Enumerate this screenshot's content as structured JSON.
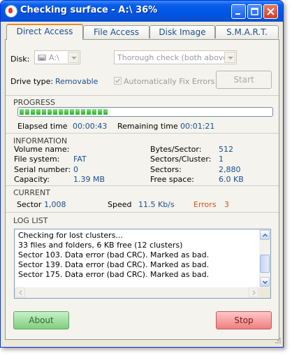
{
  "window": {
    "title": "Checking surface - A:\\ 36%"
  },
  "tabs": [
    {
      "label": "Direct Access"
    },
    {
      "label": "File Access"
    },
    {
      "label": "Disk Image"
    },
    {
      "label": "S.M.A.R.T."
    }
  ],
  "disk": {
    "label": "Disk:",
    "drive_value": "A:\\",
    "mode_value": "Thorough check (both above)",
    "drive_type_label": "Drive type:",
    "drive_type_value": "Removable",
    "auto_fix_label": "Automatically Fix Errors",
    "auto_fix_checked": true,
    "start_label": "Start"
  },
  "progress": {
    "header": "PROGRESS",
    "percent": 36,
    "elapsed_label": "Elapsed time",
    "elapsed_value": "00:00:43",
    "remaining_label": "Remaining time",
    "remaining_value": "00:01:21"
  },
  "information": {
    "header": "INFORMATION",
    "left": [
      {
        "label": "Volume name:",
        "value": ""
      },
      {
        "label": "File system:",
        "value": "FAT"
      },
      {
        "label": "Serial number:",
        "value": "0"
      },
      {
        "label": "Capacity:",
        "value": "1.39 MB"
      }
    ],
    "right": [
      {
        "label": "Bytes/Sector:",
        "value": "512"
      },
      {
        "label": "Sectors/Cluster:",
        "value": "1"
      },
      {
        "label": "Sectors:",
        "value": "2,880"
      },
      {
        "label": "Free space:",
        "value": "6.0 KB"
      }
    ]
  },
  "current": {
    "header": "CURRENT",
    "sector_label": "Sector",
    "sector_value": "1,008",
    "speed_label": "Speed",
    "speed_value": "11.5 Kb/s",
    "errors_label": "Errors",
    "errors_value": "3"
  },
  "log": {
    "header": "LOG LIST",
    "lines": [
      "Checking for lost clusters...",
      "33 files and folders, 6 KB free (12 clusters)",
      "Sector 103. Data error (bad CRC). Marked as bad.",
      "Sector 139. Data error (bad CRC). Marked as bad.",
      "Sector 175. Data error (bad CRC). Marked as bad."
    ]
  },
  "buttons": {
    "about": "About",
    "stop": "Stop"
  },
  "colors": {
    "accent": "#1b4f8c",
    "error": "#d9531e",
    "progress": "#27b327"
  }
}
